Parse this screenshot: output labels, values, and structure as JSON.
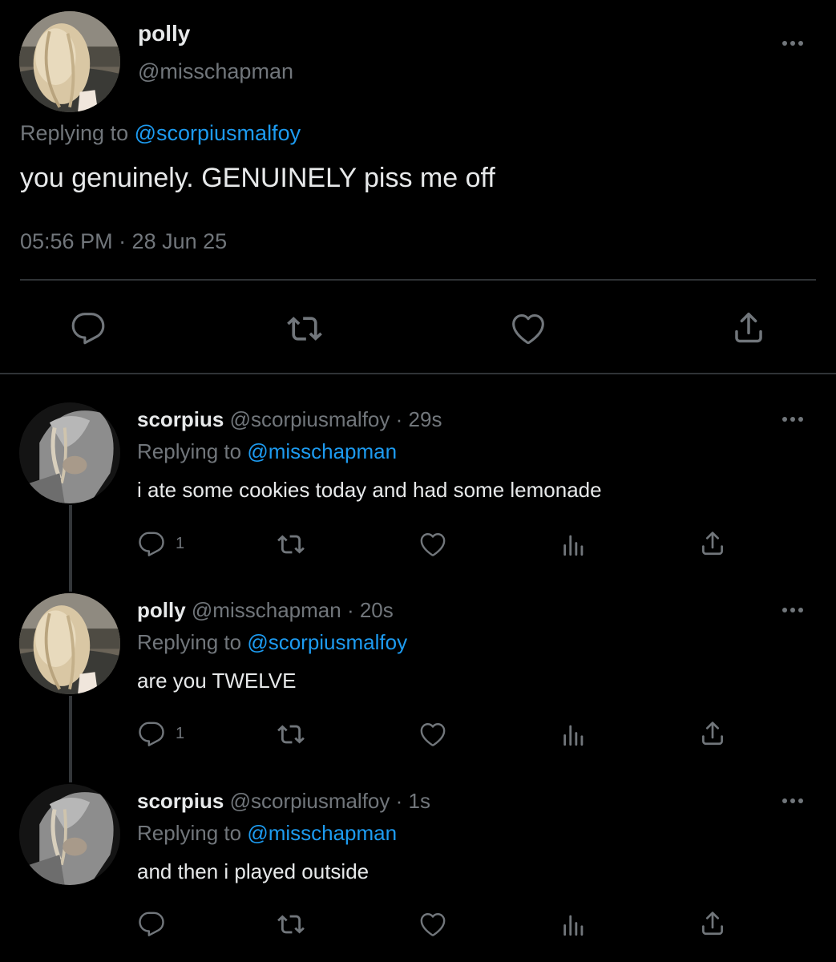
{
  "main_tweet": {
    "name": "polly",
    "handle": "@misschapman",
    "replying_prefix": "Replying to",
    "replying_to": "@scorpiusmalfoy",
    "text": "you genuinely. GENUINELY piss me off",
    "timestamp": "05:56 PM · 28 Jun 25",
    "actions": [
      "reply-icon",
      "retweet-icon",
      "like-icon",
      "share-icon"
    ]
  },
  "replies": [
    {
      "name": "scorpius",
      "handle": "@scorpiusmalfoy",
      "age": "· 29s",
      "replying_prefix": "Replying to",
      "replying_to": "@misschapman",
      "text": "i ate some cookies today and had some lemonade",
      "reply_count": "1"
    },
    {
      "name": "polly",
      "handle": "@misschapman",
      "age": "· 20s",
      "replying_prefix": "Replying to",
      "replying_to": "@scorpiusmalfoy",
      "text": "are you TWELVE",
      "reply_count": "1"
    },
    {
      "name": "scorpius",
      "handle": "@scorpiusmalfoy",
      "age": "· 1s",
      "replying_prefix": "Replying to",
      "replying_to": "@misschapman",
      "text": "and then i played outside",
      "reply_count": ""
    }
  ],
  "colors": {
    "background": "#000000",
    "text": "#e7e9ea",
    "muted": "#71767b",
    "link": "#1d9bf0",
    "divider": "#2f3336"
  }
}
